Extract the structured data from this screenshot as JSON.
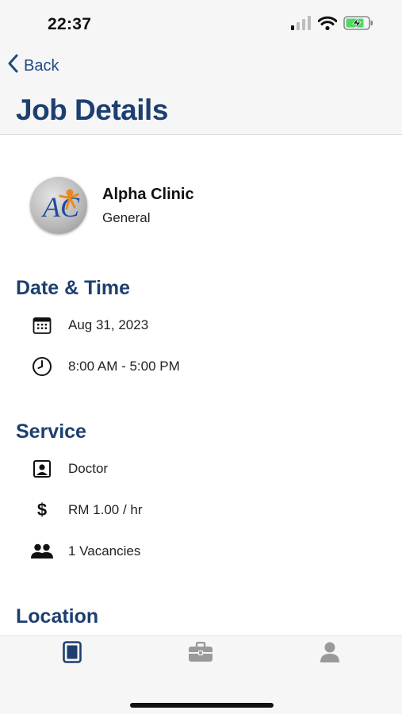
{
  "status_bar": {
    "time": "22:37"
  },
  "nav": {
    "back_label": "Back",
    "title": "Job Details"
  },
  "clinic": {
    "name": "Alpha Clinic",
    "category": "General",
    "logo_text": "AC"
  },
  "sections": {
    "datetime": {
      "title": "Date & Time",
      "date": "Aug 31, 2023",
      "time_range": "8:00 AM - 5:00 PM"
    },
    "service": {
      "title": "Service",
      "role": "Doctor",
      "rate": "RM 1.00 / hr",
      "vacancies": "1 Vacancies"
    },
    "location": {
      "title": "Location"
    }
  },
  "tabbar": {
    "items": [
      {
        "icon": "document-icon",
        "active": true
      },
      {
        "icon": "briefcase-icon",
        "active": false
      },
      {
        "icon": "person-icon",
        "active": false
      }
    ]
  },
  "colors": {
    "accent": "#1d3f70",
    "link": "#1f4a86",
    "inactive_tab": "#9a9a9a",
    "battery": "#4cd964"
  }
}
